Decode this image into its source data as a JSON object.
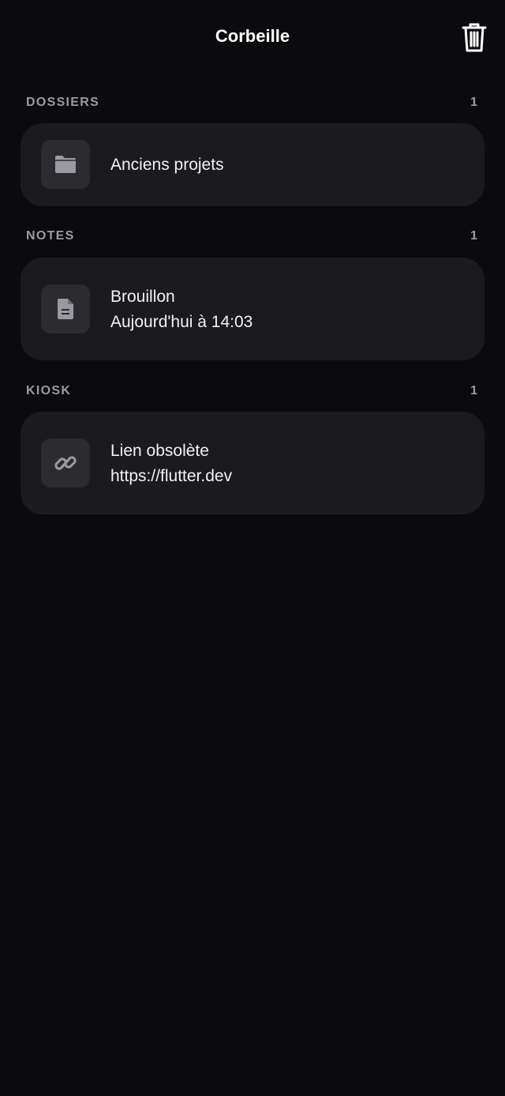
{
  "header": {
    "title": "Corbeille",
    "action_icon": "trash-icon"
  },
  "sections": [
    {
      "title": "DOSSIERS",
      "count": "1",
      "items": [
        {
          "icon": "folder-icon",
          "title": "Anciens projets"
        }
      ]
    },
    {
      "title": "NOTES",
      "count": "1",
      "items": [
        {
          "icon": "document-icon",
          "title": "Brouillon",
          "subtitle": "Aujourd'hui à 14:03"
        }
      ]
    },
    {
      "title": "KIOSK",
      "count": "1",
      "items": [
        {
          "icon": "link-icon",
          "title": "Lien obsolète",
          "subtitle": "https://flutter.dev"
        }
      ]
    }
  ],
  "colors": {
    "background": "#0b0b0d",
    "card": "#1b1b1f",
    "icon_box": "#2b2b30",
    "section_label": "#9a9aa0",
    "text": "#f2f2f4",
    "icon": "#9a9aa0"
  }
}
